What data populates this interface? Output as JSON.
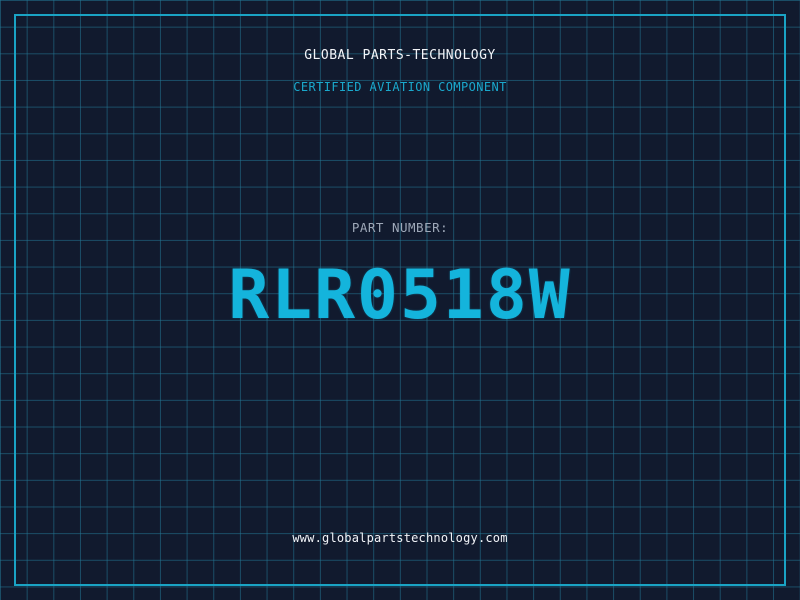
{
  "header": {
    "company": "GLOBAL PARTS-TECHNOLOGY",
    "tagline": "CERTIFIED AVIATION COMPONENT"
  },
  "part": {
    "label": "PART NUMBER:",
    "number": "RLR0518W"
  },
  "footer": {
    "url": "www.globalpartstechnology.com"
  },
  "colors": {
    "background": "#111a2e",
    "grid": "#237896",
    "accent": "#14b4dc",
    "text": "#f2f4f8",
    "muted": "#9ea8b8"
  }
}
